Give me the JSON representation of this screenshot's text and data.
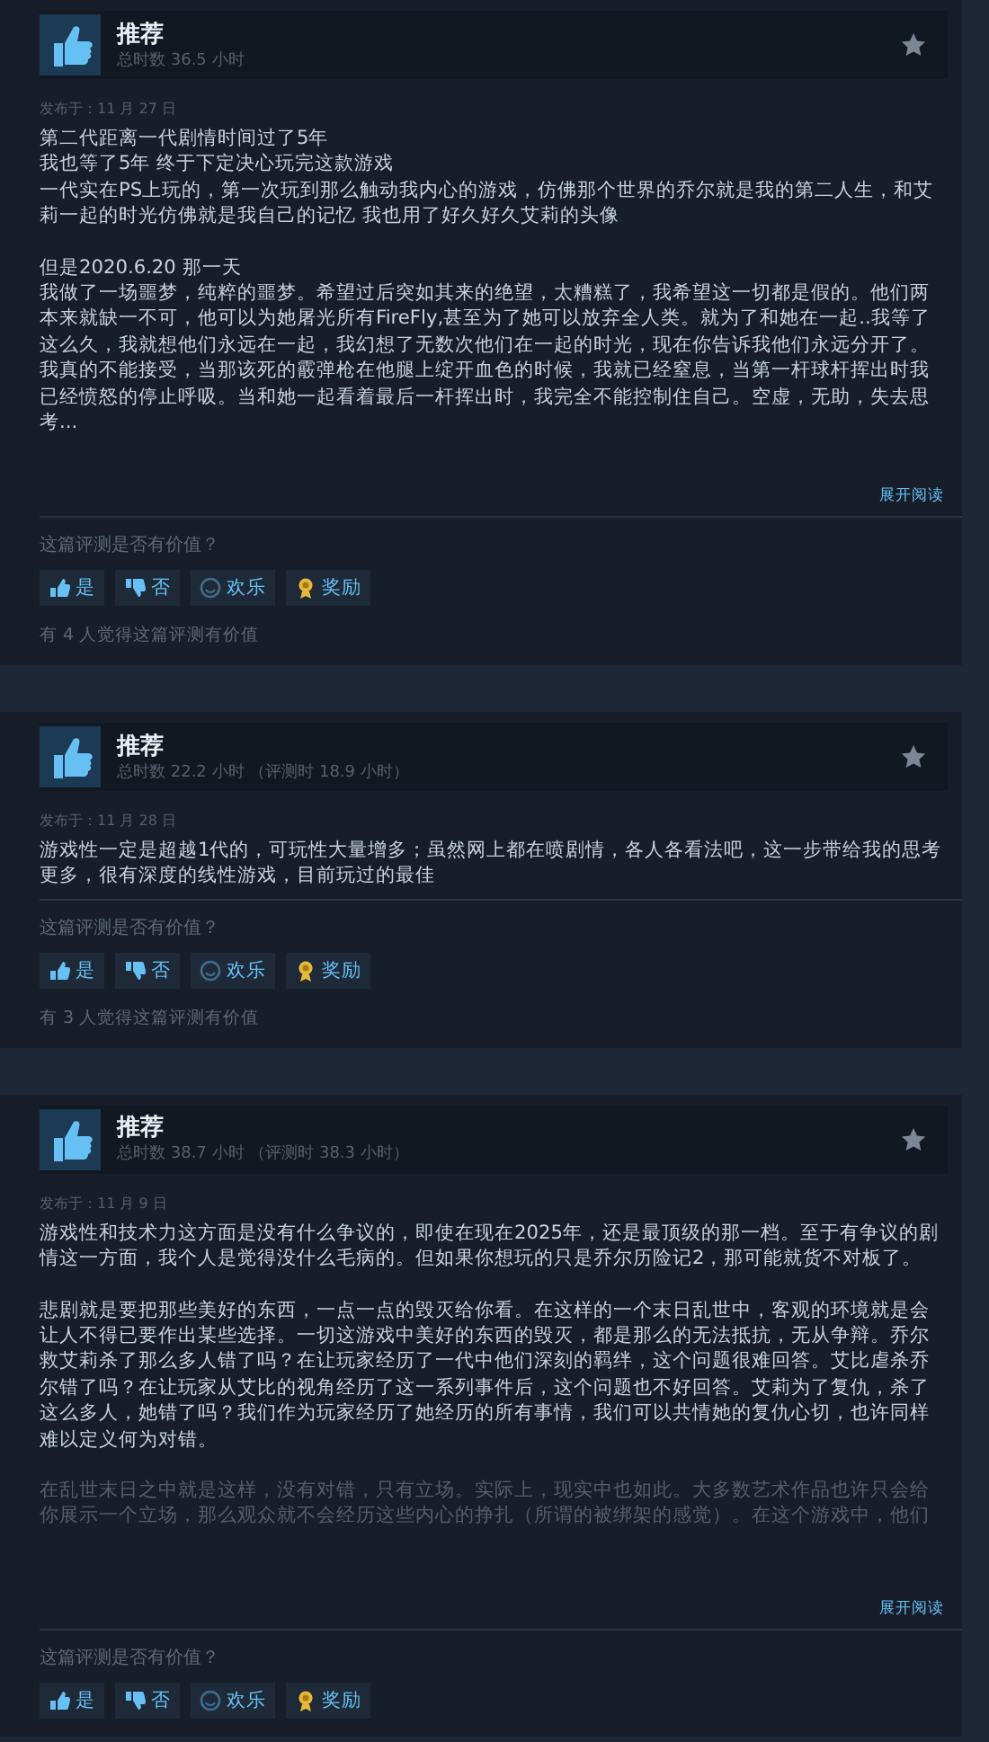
{
  "reviews": [
    {
      "recommended": true,
      "verdict": "推荐",
      "playtime": "总时数 36.5 小时",
      "posted": "发布于：11 月 27 日",
      "paragraphs": [
        {
          "lines": [
            "第二代距离一代剧情时间过了5年",
            "我也等了5年 终于下定决心玩完这款游戏",
            "一代实在PS上玩的，第一次玩到那么触动我内心的游戏，仿佛那个世界的乔尔就是我的第二人生，和艾莉一起的时光仿佛就是我自己的记忆 我也用了好久好久艾莉的头像"
          ],
          "faded": false
        },
        {
          "lines": [
            "但是2020.6.20 那一天",
            "我做了一场噩梦，纯粹的噩梦。希望过后突如其来的绝望，太糟糕了，我希望这一切都是假的。他们两本来就缺一不可，他可以为她屠光所有FireFly,甚至为了她可以放弃全人类。就为了和她在一起..我等了这么久，我就想他们永远在一起，我幻想了无数次他们在一起的时光，现在你告诉我他们永远分开了。我真的不能接受，当那该死的霰弹枪在他腿上绽开血色的时候，我就已经窒息，当第一杆球杆挥出时我已经愤怒的停止呼吸。当和她一起看着最后一杆挥出时，我完全不能控制住自己。空虚，无助，失去思考..."
          ],
          "faded": false
        }
      ],
      "expand": "展开阅读",
      "question": "这篇评测是否有价值？",
      "buttons": [
        {
          "kind": "yes",
          "label": "是"
        },
        {
          "kind": "no",
          "label": "否"
        },
        {
          "kind": "funny",
          "label": "欢乐"
        },
        {
          "kind": "award",
          "label": "奖励"
        }
      ],
      "helpful": "有 4 人觉得这篇评测有价值"
    },
    {
      "recommended": true,
      "verdict": "推荐",
      "playtime": "总时数 22.2 小时 （评测时 18.9 小时）",
      "posted": "发布于：11 月 28 日",
      "paragraphs": [
        {
          "lines": [
            "游戏性一定是超越1代的，可玩性大量增多；虽然网上都在喷剧情，各人各看法吧，这一步带给我的思考更多，很有深度的线性游戏，目前玩过的最佳"
          ],
          "faded": false
        }
      ],
      "question": "这篇评测是否有价值？",
      "buttons": [
        {
          "kind": "yes",
          "label": "是"
        },
        {
          "kind": "no",
          "label": "否"
        },
        {
          "kind": "funny",
          "label": "欢乐"
        },
        {
          "kind": "award",
          "label": "奖励"
        }
      ],
      "helpful": "有 3 人觉得这篇评测有价值"
    },
    {
      "recommended": true,
      "verdict": "推荐",
      "playtime": "总时数 38.7 小时 （评测时 38.3 小时）",
      "posted": "发布于：11 月 9 日",
      "paragraphs": [
        {
          "lines": [
            "游戏性和技术力这方面是没有什么争议的，即使在现在2025年，还是最顶级的那一档。至于有争议的剧情这一方面，我个人是觉得没什么毛病的。但如果你想玩的只是乔尔历险记2，那可能就货不对板了。"
          ],
          "faded": false
        },
        {
          "lines": [
            "悲剧就是要把那些美好的东西，一点一点的毁灭给你看。在这样的一个末日乱世中，客观的环境就是会让人不得已要作出某些选择。一切这游戏中美好的东西的毁灭，都是那么的无法抵抗，无从争辩。乔尔救艾莉杀了那么多人错了吗？在让玩家经历了一代中他们深刻的羁绊，这个问题很难回答。艾比虐杀乔尔错了吗？在让玩家从艾比的视角经历了这一系列事件后，这个问题也不好回答。艾莉为了复仇，杀了这么多人，她错了吗？我们作为玩家经历了她经历的所有事情，我们可以共情她的复仇心切，也许同样难以定义何为对错。"
          ],
          "faded": false
        },
        {
          "lines": [
            "在乱世末日之中就是这样，没有对错，只有立场。实际上，现实中也如此。大多数艺术作品也许只会给你展示一个立场，那么观众就不会经历这些内心的挣扎（所谓的被绑架的感觉）。在这个游戏中，他们"
          ],
          "faded": true
        }
      ],
      "expand": "展开阅读",
      "question": "这篇评测是否有价值？",
      "buttons": [
        {
          "kind": "yes",
          "label": "是"
        },
        {
          "kind": "no",
          "label": "否"
        },
        {
          "kind": "funny",
          "label": "欢乐"
        },
        {
          "kind": "award",
          "label": "奖励"
        }
      ]
    }
  ]
}
